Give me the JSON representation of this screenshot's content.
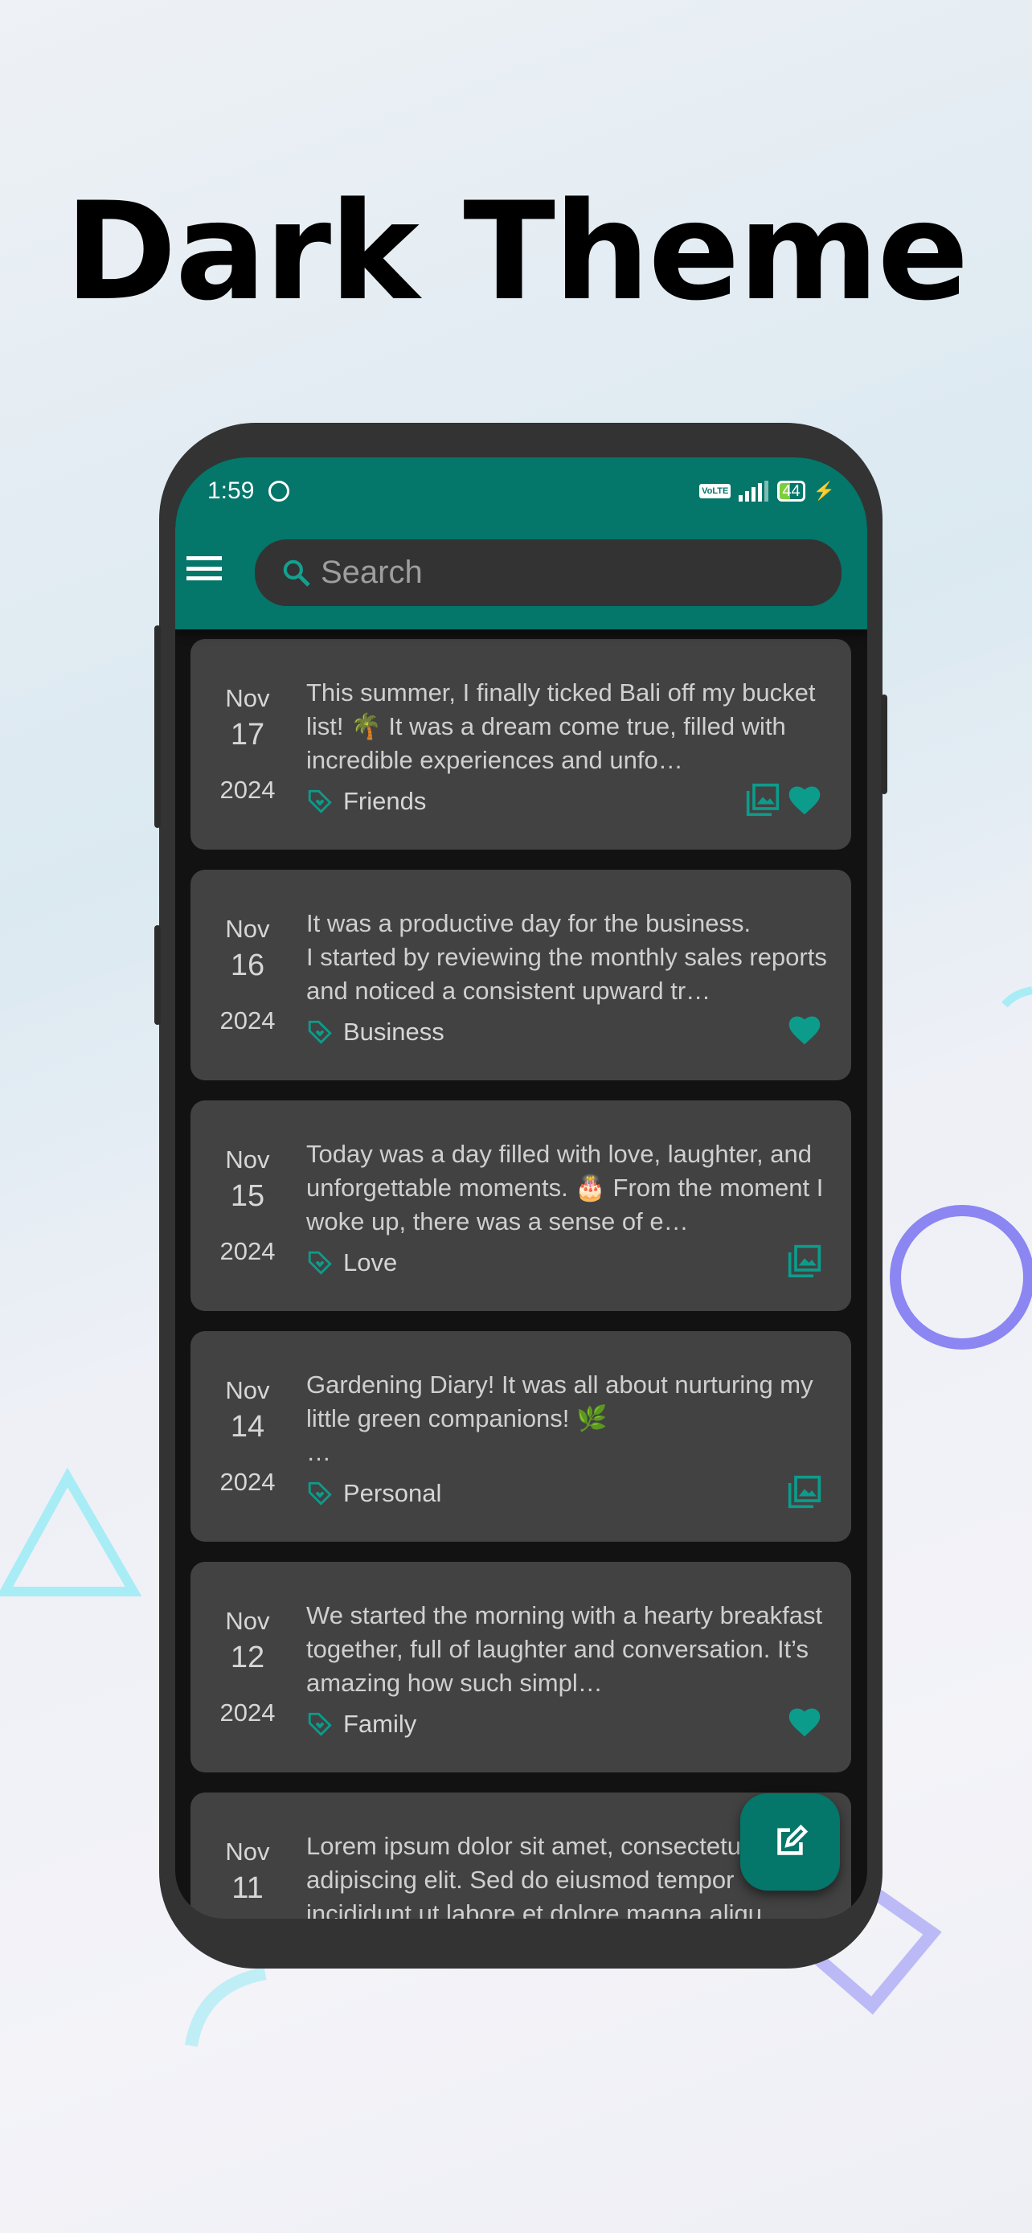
{
  "headline": "Dark Theme",
  "colors": {
    "accent": "#04766a",
    "icon_teal": "#0c9c8c",
    "card": "#424242",
    "background": "#121212"
  },
  "status_bar": {
    "time": "1:59",
    "network": "VoLTE",
    "battery": "44"
  },
  "search": {
    "placeholder": "Search"
  },
  "entries": [
    {
      "month": "Nov",
      "day": "17",
      "year": "2024",
      "text": "This summer, I finally ticked Bali off my bucket list! 🌴 It was a dream come true, filled with incredible experiences and unfo…",
      "tag": "Friends",
      "has_image": true,
      "favorite": true
    },
    {
      "month": "Nov",
      "day": "16",
      "year": "2024",
      "text": " It was a productive day for the business.\nI started by reviewing the monthly sales reports and noticed a consistent upward tr…",
      "tag": "Business",
      "has_image": false,
      "favorite": true
    },
    {
      "month": "Nov",
      "day": "15",
      "year": "2024",
      "text": "Today was a day filled with love, laughter, and unforgettable moments. 🎂 From the moment I woke up, there was a sense of e…",
      "tag": "Love",
      "has_image": true,
      "favorite": false
    },
    {
      "month": "Nov",
      "day": "14",
      "year": "2024",
      "text": "Gardening Diary! It  was all about nurturing my little green companions! 🌿\n…",
      "tag": "Personal",
      "has_image": true,
      "favorite": false
    },
    {
      "month": "Nov",
      "day": "12",
      "year": "2024",
      "text": "We started the morning with a hearty breakfast together, full of laughter and conversation. It’s amazing how such simpl…",
      "tag": "Family",
      "has_image": false,
      "favorite": true
    },
    {
      "month": "Nov",
      "day": "11",
      "year": "",
      "text": "Lorem ipsum dolor sit amet, consectetur adipiscing elit. Sed do eiusmod tempor incididunt ut labore et dolore magna aliqu…",
      "tag": "",
      "has_image": false,
      "favorite": false
    }
  ],
  "fab": {
    "icon": "edit-note-icon"
  }
}
